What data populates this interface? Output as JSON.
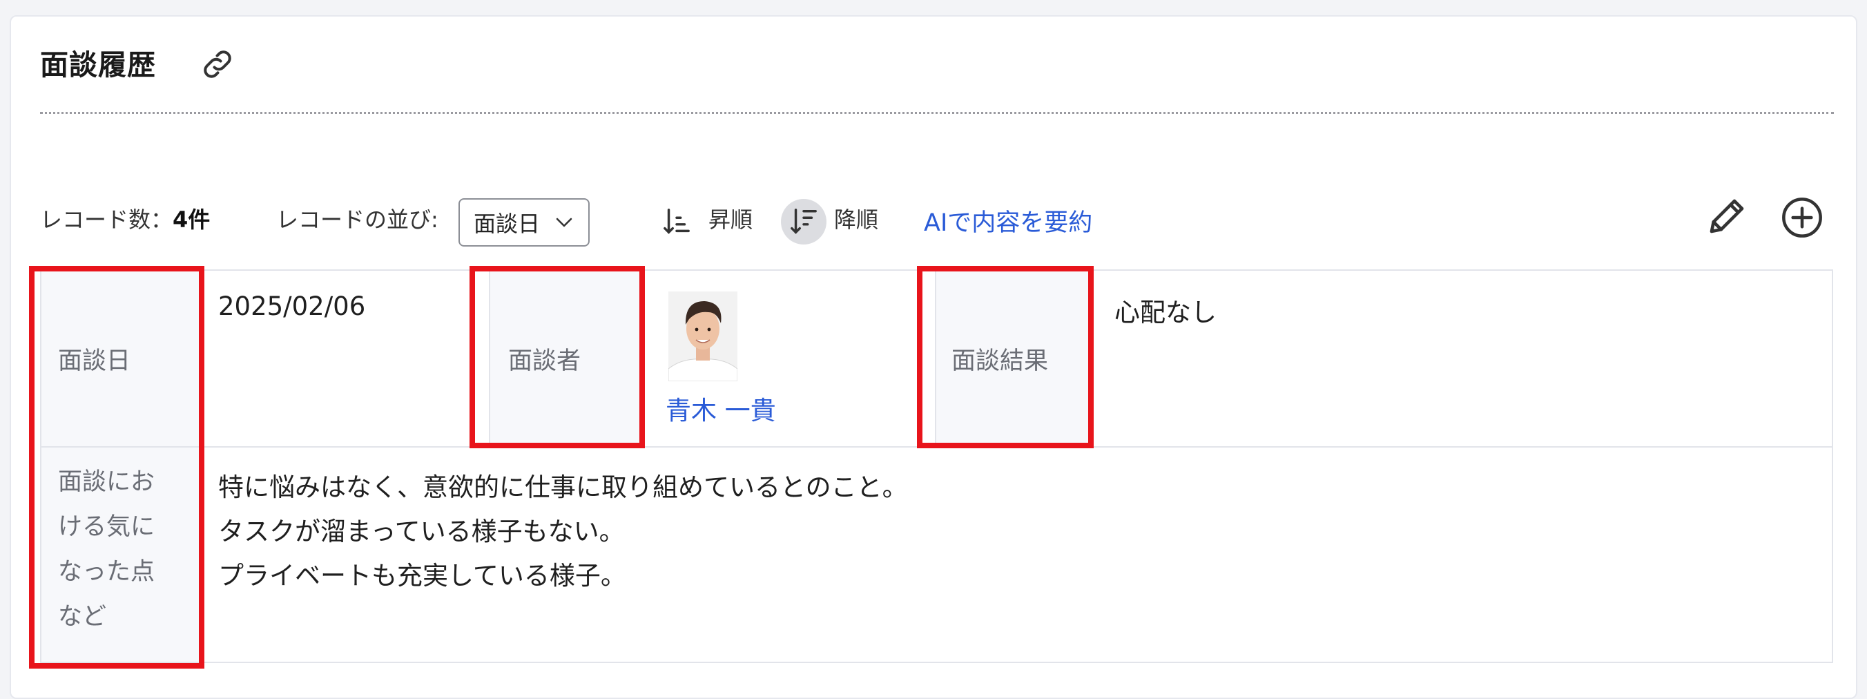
{
  "section": {
    "title": "面談履歴",
    "link_icon": "link-icon"
  },
  "toolbar": {
    "record_count_label": "レコード数：",
    "record_count_value": "4件",
    "sort_label": "レコードの並び:",
    "sort_selected": "面談日",
    "asc_label": "昇順",
    "desc_label": "降順",
    "ai_summary_label": "AIで内容を要約",
    "edit_icon": "pencil-icon",
    "add_icon": "plus-circle-icon"
  },
  "record": {
    "date_label": "面談日",
    "date_value": "2025/02/06",
    "interviewer_label": "面談者",
    "interviewer_name": "青木 一貴",
    "result_label": "面談結果",
    "result_value": "心配なし",
    "concerns_label_lines": [
      "面談にお",
      "ける気に",
      "なった点",
      "など"
    ],
    "concerns_lines": [
      "特に悩みはなく、意欲的に仕事に取り組めているとのこと。",
      "タスクが溜まっている様子もない。",
      "プライベートも充実している様子。"
    ]
  },
  "colors": {
    "accent_link": "#2a5bd7",
    "highlight": "#e8141b",
    "header_cell_bg": "#f7f8fb"
  }
}
